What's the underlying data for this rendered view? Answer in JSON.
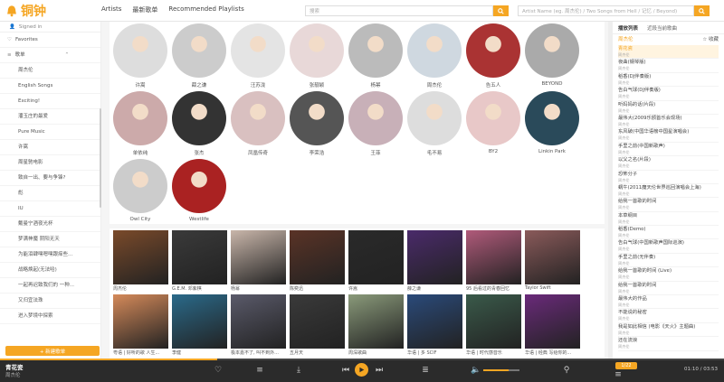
{
  "app": {
    "logo_text": "铜钟"
  },
  "nav": {
    "artists": "Artists",
    "latest": "最新歌单",
    "recommended": "Recommended Playlists"
  },
  "search": {
    "left_placeholder": "搜索",
    "right_placeholder": "Artist Name (eg. 周杰伦) / Two Songs from Hell / 记忆 / Beyond)"
  },
  "sidebar": {
    "signed_in": "Signed in",
    "favorites": "Favorites",
    "playlists_header": "歌单",
    "items": [
      "周杰伦",
      "English Songs",
      "Exciting!",
      "潘玉庄的最爱",
      "Pure Music",
      "许嵩",
      "周星驰电影",
      "致自一出、要与争锋?",
      "彪",
      "IU",
      "戴曼宁酒夜光杯",
      "梦满神魔 阴阳无天",
      "为能泪肆嘿嗯嘿跟痒些...",
      "战略焕起(无法哈)",
      "一起再迟致我们的 一种...",
      "又归宜法珠",
      "进入梦境中探索"
    ],
    "new_playlist": "+ 新建歌单"
  },
  "artists": [
    "许嵩",
    "薛之谦",
    "汪苏泷",
    "张靓颖",
    "杨幂",
    "周杰伦",
    "告五人",
    "BEYOND",
    "单依纯",
    "张杰",
    "凤凰传奇",
    "李荣浩",
    "王菲",
    "毛不易",
    "BY2",
    "Linkin Park",
    "Owl City",
    "Westlife"
  ],
  "albums": [
    {
      "title": "周杰伦",
      "color": "#7a4a2a"
    },
    {
      "title": "G.E.M. 邓紫棋",
      "color": "#3a3a3a"
    },
    {
      "title": "杨幂",
      "color": "#c9b6aa"
    },
    {
      "title": "陈奕迅",
      "color": "#5a3326"
    },
    {
      "title": "许嵩",
      "color": "#2a2a2a"
    },
    {
      "title": "薛之谦",
      "color": "#4a2a6a"
    },
    {
      "title": "95 后看过的青春回忆",
      "color": "#b05a7a"
    },
    {
      "title": "Taylor Swift",
      "color": "#8a5a5a"
    },
    {
      "title": "粤语 | 好听的歌 人生...",
      "color": "#d58a5a"
    },
    {
      "title": "李健",
      "color": "#2a6a8a"
    },
    {
      "title": "极本嘉不了, 叫不到外...",
      "color": "#5a5a6a"
    },
    {
      "title": "五月天",
      "color": "#3a3a3a"
    },
    {
      "title": "周深歌曲",
      "color": "#8a9a7a"
    },
    {
      "title": "华语 | 多 SCIF",
      "color": "#2a4a7a"
    },
    {
      "title": "华语 | 时代感音乐",
      "color": "#3a5a4a"
    },
    {
      "title": "华语 | 经典 写给你的...",
      "color": "#6a2a7a"
    }
  ],
  "queue": {
    "tab_playlist": "播放列表",
    "tab_record": "近段当前歌曲",
    "header": "周杰伦",
    "favorite": "☆ 收藏",
    "items": [
      {
        "t": "青花瓷",
        "a": "周杰伦"
      },
      {
        "t": "夜曲(钢琴版)",
        "a": "周杰伦"
      },
      {
        "t": "稻香(DJ伴奏版)",
        "a": "周杰伦"
      },
      {
        "t": "告白气球(DJ伴奏版)",
        "a": "周杰伦"
      },
      {
        "t": "听妈妈的话(片段)",
        "a": "周杰伦"
      },
      {
        "t": "最伟大(2009乐颁首乐会现场)",
        "a": "周杰伦"
      },
      {
        "t": "东风破(中国华语榜中国星演唱会)",
        "a": "周杰伦"
      },
      {
        "t": "手里之前(中国新歌声)",
        "a": "周杰伦"
      },
      {
        "t": "以父之名(片段)",
        "a": "周杰伦"
      },
      {
        "t": "恐怖分子",
        "a": "周杰伦"
      },
      {
        "t": "蜗牛(2011魔天伦世界巡回演唱会上海)",
        "a": "周杰伦"
      },
      {
        "t": "给我一首歌的时间",
        "a": "周杰伦"
      },
      {
        "t": "本草纲目",
        "a": "周杰伦"
      },
      {
        "t": "稻香(Demo)",
        "a": "周杰伦"
      },
      {
        "t": "告白气球(中国新歌声国际巡演)",
        "a": "周杰伦"
      },
      {
        "t": "手里之前(无伴奏)",
        "a": "周杰伦"
      },
      {
        "t": "给我一首歌的时间 (Live)",
        "a": "周杰伦"
      },
      {
        "t": "给我一首歌的时间",
        "a": "周杰伦"
      },
      {
        "t": "最伟大的作品",
        "a": "周杰伦"
      },
      {
        "t": "不能说的秘密",
        "a": "周杰伦"
      },
      {
        "t": "我是如此相信 (电影《天火》主题曲)",
        "a": "周杰伦"
      },
      {
        "t": "还在流浪",
        "a": "周杰伦"
      }
    ]
  },
  "player": {
    "title": "青花瓷",
    "artist": "周杰伦",
    "time": "01:10 / 03:53",
    "progress": 0.3,
    "volume": 0.7,
    "badge": "1/22"
  }
}
